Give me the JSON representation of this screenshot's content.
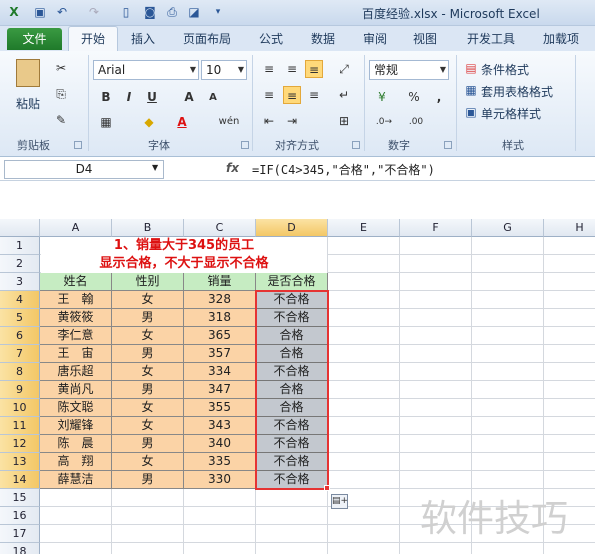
{
  "window": {
    "title": "百度经验.xlsx  -  Microsoft Excel"
  },
  "quick_access": {
    "icons": [
      "excel-logo-icon",
      "save-icon",
      "undo-icon",
      "redo-icon",
      "new-icon",
      "camera-icon",
      "print-icon",
      "page-setup-icon"
    ]
  },
  "ribbon_tabs": {
    "file": "文件",
    "home": "开始",
    "insert": "插入",
    "page_layout": "页面布局",
    "formulas": "公式",
    "data": "数据",
    "review": "审阅",
    "view": "视图",
    "developer": "开发工具",
    "addins": "加载项"
  },
  "clipboard": {
    "paste_label": "粘贴",
    "group_label": "剪贴板"
  },
  "font_group": {
    "font_name": "Arial",
    "font_size": "10",
    "bold": "B",
    "italic": "I",
    "underline": "U",
    "font_grow": "A",
    "font_shrink": "A",
    "phonetic": "wén",
    "group_label": "字体"
  },
  "alignment_group": {
    "group_label": "对齐方式"
  },
  "number_group": {
    "format": "常规",
    "percent": "%",
    "comma": ",",
    "group_label": "数字"
  },
  "styles_group": {
    "conditional_formatting": "条件格式",
    "format_as_table": "套用表格格式",
    "cell_styles": "单元格样式",
    "group_label": "样式"
  },
  "formula_bar": {
    "name_box": "D4",
    "fx": "fx",
    "formula": "=IF(C4>345,\"合格\",\"不合格\")"
  },
  "sheet": {
    "columns": [
      "A",
      "B",
      "C",
      "D",
      "E",
      "F",
      "G",
      "H"
    ],
    "selected_column": "D",
    "title_line1": "1、销量大于345的员工",
    "title_line2": "显示合格，不大于显示不合格",
    "headers": [
      "姓名",
      "性别",
      "销量",
      "是否合格"
    ],
    "rows": [
      {
        "row": "4",
        "name": "王　翰",
        "gender": "女",
        "sales": "328",
        "result": "不合格"
      },
      {
        "row": "5",
        "name": "黄筱筱",
        "gender": "男",
        "sales": "318",
        "result": "不合格"
      },
      {
        "row": "6",
        "name": "李仁意",
        "gender": "女",
        "sales": "365",
        "result": "合格"
      },
      {
        "row": "7",
        "name": "王　宙",
        "gender": "男",
        "sales": "357",
        "result": "合格"
      },
      {
        "row": "8",
        "name": "唐乐超",
        "gender": "女",
        "sales": "334",
        "result": "不合格"
      },
      {
        "row": "9",
        "name": "黄尚凡",
        "gender": "男",
        "sales": "347",
        "result": "合格"
      },
      {
        "row": "10",
        "name": "陈文聪",
        "gender": "女",
        "sales": "355",
        "result": "合格"
      },
      {
        "row": "11",
        "name": "刘耀锋",
        "gender": "女",
        "sales": "343",
        "result": "不合格"
      },
      {
        "row": "12",
        "name": "陈　晨",
        "gender": "男",
        "sales": "340",
        "result": "不合格"
      },
      {
        "row": "13",
        "name": "高　翔",
        "gender": "女",
        "sales": "335",
        "result": "不合格"
      },
      {
        "row": "14",
        "name": "薛慧洁",
        "gender": "男",
        "sales": "330",
        "result": "不合格"
      }
    ],
    "row_numbers": [
      "1",
      "2",
      "3",
      "4",
      "5",
      "6",
      "7",
      "8",
      "9",
      "10",
      "11",
      "12",
      "13",
      "14",
      "15",
      "16",
      "17",
      "18"
    ]
  },
  "watermark": "软件技巧",
  "colors": {
    "file_tab": "#1f7a2a",
    "title_text": "#dd1111",
    "header_fill": "#c6ecc2",
    "data_fill": "#fbd3a6",
    "result_fill": "#c3c8cf",
    "selection_border": "#e53333"
  }
}
